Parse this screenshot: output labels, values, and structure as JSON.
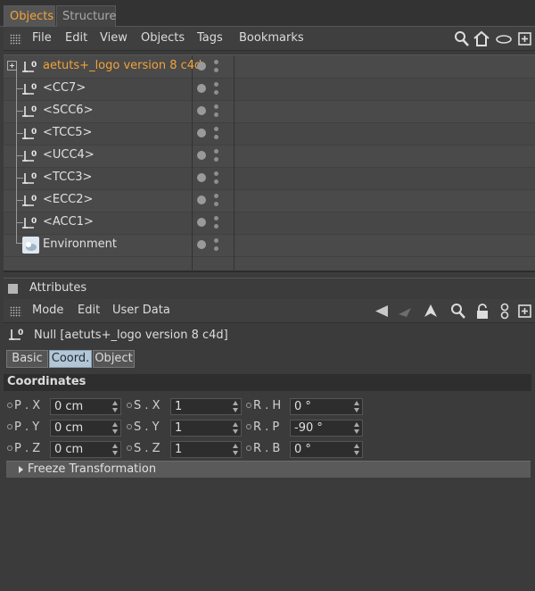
{
  "tabs": [
    {
      "label": "Objects"
    },
    {
      "label": "Structure"
    }
  ],
  "object_menu": [
    "File",
    "Edit",
    "View",
    "Objects",
    "Tags",
    "Bookmarks"
  ],
  "object_tools": [
    "search-icon",
    "home-icon",
    "eye-icon",
    "new-panel-icon"
  ],
  "objects": [
    {
      "name": "aetuts+_logo version 8 c4d",
      "icon": "null-icon",
      "selected": true
    },
    {
      "name": "<CC7>",
      "icon": "null-icon"
    },
    {
      "name": "<SCC6>",
      "icon": "null-icon"
    },
    {
      "name": "<TCC5>",
      "icon": "null-icon"
    },
    {
      "name": "<UCC4>",
      "icon": "null-icon"
    },
    {
      "name": "<TCC3>",
      "icon": "null-icon"
    },
    {
      "name": "<ECC2>",
      "icon": "null-icon"
    },
    {
      "name": "<ACC1>",
      "icon": "null-icon"
    },
    {
      "name": "Environment",
      "icon": "environment-icon"
    }
  ],
  "attributes": {
    "title": "Attributes",
    "menu": [
      "Mode",
      "Edit",
      "User Data"
    ],
    "tools": [
      "back-arrow-icon",
      "forward-arrow-icon",
      "up-arrow-icon",
      "search-icon",
      "lock-icon",
      "link-icon",
      "new-panel-icon"
    ],
    "object_label": "Null [aetuts+_logo version 8 c4d]",
    "subtabs": [
      {
        "label": "Basic"
      },
      {
        "label": "Coord.",
        "active": true
      },
      {
        "label": "Object"
      }
    ],
    "section_title": "Coordinates",
    "fields": [
      [
        {
          "label": "P . X",
          "value": "0 cm"
        },
        {
          "label": "S . X",
          "value": "1"
        },
        {
          "label": "R . H",
          "value": "0 °"
        }
      ],
      [
        {
          "label": "P . Y",
          "value": "0 cm"
        },
        {
          "label": "S . Y",
          "value": "1"
        },
        {
          "label": "R . P",
          "value": "-90 °"
        }
      ],
      [
        {
          "label": "P . Z",
          "value": "0 cm"
        },
        {
          "label": "S . Z",
          "value": "1"
        },
        {
          "label": "R . B",
          "value": "0 °"
        }
      ]
    ],
    "freeze_label": "Freeze Transformation"
  },
  "colors": {
    "accent": "#f2a23a",
    "active_subtab": "#b3c6d6"
  }
}
